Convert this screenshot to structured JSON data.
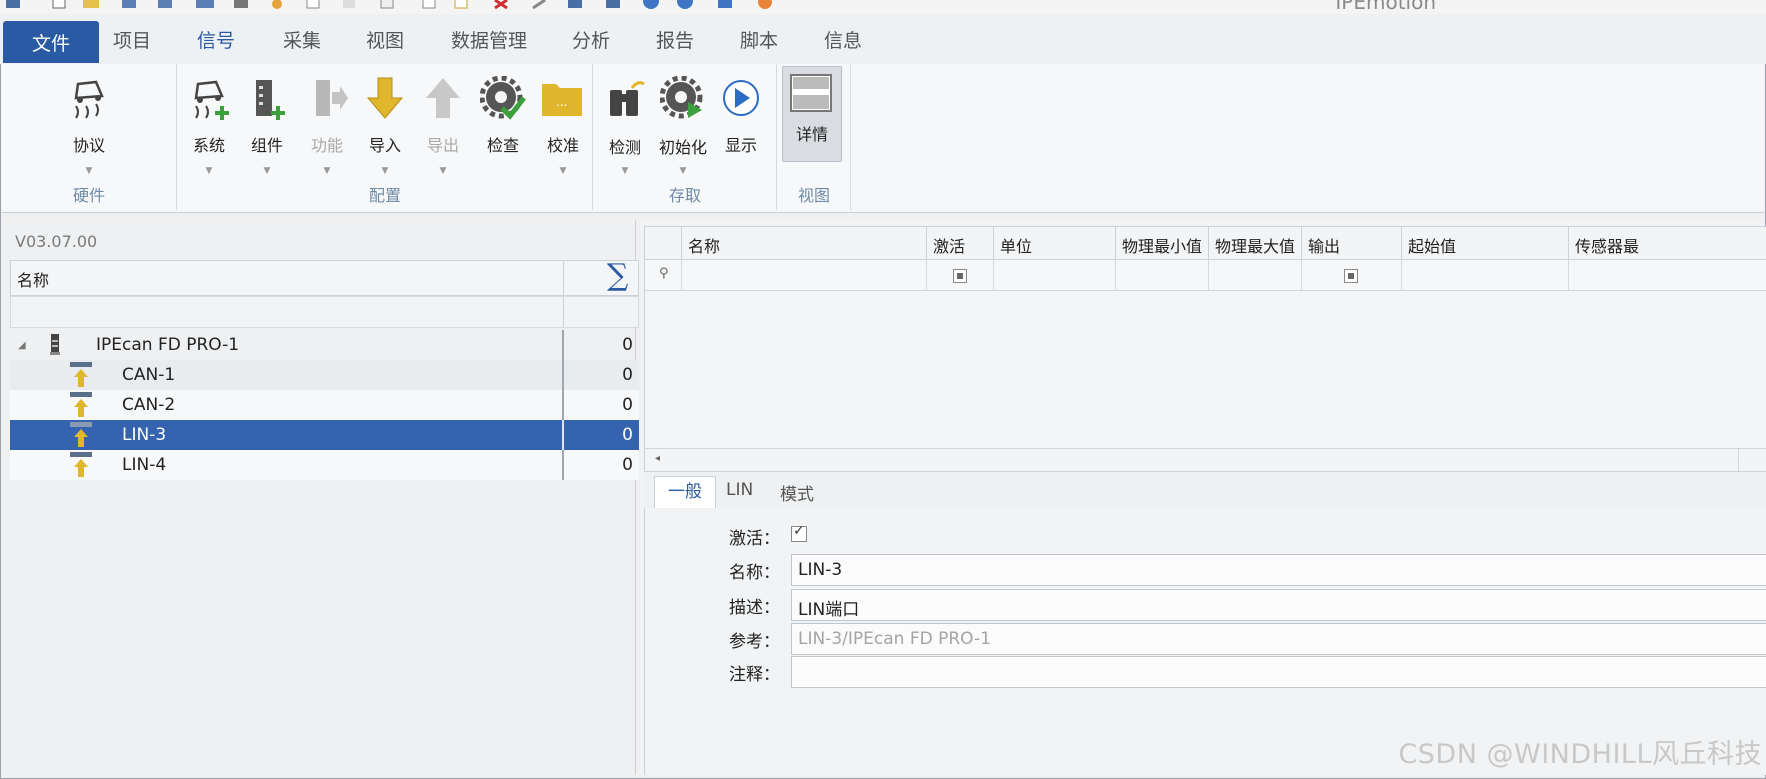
{
  "app": {
    "title": "IPEmotion"
  },
  "menu": {
    "tabs": [
      "文件",
      "项目",
      "信号",
      "采集",
      "视图",
      "数据管理",
      "分析",
      "报告",
      "脚本",
      "信息"
    ],
    "active": "信号"
  },
  "ribbon": {
    "groups": {
      "hardware": "硬件",
      "config": "配置",
      "access": "存取",
      "view": "视图"
    },
    "buttons": {
      "protocol": "协议",
      "system": "系统",
      "component": "组件",
      "function": "功能",
      "import": "导入",
      "export": "导出",
      "check": "检查",
      "calibrate": "校准",
      "detect": "检测",
      "initialize": "初始化",
      "display": "显示",
      "details": "详情"
    }
  },
  "left_panel": {
    "version": "V03.07.00",
    "column_name": "名称",
    "sigma": "∑",
    "tree": [
      {
        "label": "IPEcan FD PRO-1",
        "count": "0",
        "level": 0,
        "type": "device"
      },
      {
        "label": "CAN-1",
        "count": "0",
        "level": 1,
        "type": "port"
      },
      {
        "label": "CAN-2",
        "count": "0",
        "level": 1,
        "type": "port"
      },
      {
        "label": "LIN-3",
        "count": "0",
        "level": 1,
        "type": "port",
        "selected": true
      },
      {
        "label": "LIN-4",
        "count": "0",
        "level": 1,
        "type": "port"
      }
    ]
  },
  "grid": {
    "columns": [
      "名称",
      "激活",
      "单位",
      "物理最小值",
      "物理最大值",
      "输出",
      "起始值",
      "传感器最"
    ]
  },
  "detail": {
    "tabs": [
      "一般",
      "LIN",
      "模式"
    ],
    "active_tab": "一般",
    "labels": {
      "active": "激活：",
      "name": "名称：",
      "description": "描述：",
      "reference": "参考：",
      "comment": "注释："
    },
    "values": {
      "active": true,
      "name": "LIN-3",
      "description": "LIN端口",
      "reference": "LIN-3/IPEcan FD PRO-1",
      "comment": ""
    }
  },
  "watermark": "CSDN @WINDHILL风丘科技",
  "colors": {
    "accent": "#2b5aa5",
    "selection": "#3563b0",
    "icon_gold": "#d9b22e"
  }
}
